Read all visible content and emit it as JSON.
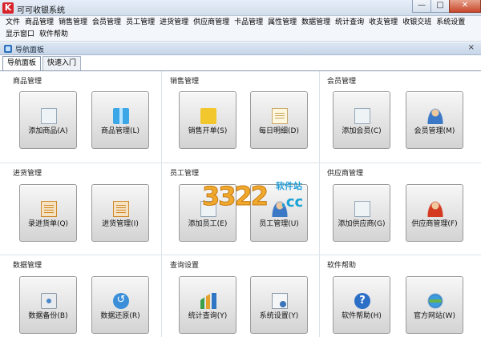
{
  "window": {
    "logo_letter": "K",
    "title": "可可收银系统",
    "buttons": [
      "—",
      "□",
      "✕"
    ]
  },
  "menu": [
    "文件",
    "商品管理",
    "销售管理",
    "会员管理",
    "员工管理",
    "进货管理",
    "供应商管理",
    "卡品管理",
    "属性管理",
    "数据管理",
    "统计查询",
    "收支管理",
    "收银交班",
    "系统设置",
    "显示窗口",
    "软件帮助"
  ],
  "nav_panel": {
    "title": "导航面板",
    "close": "×",
    "tabs": [
      {
        "label": "导航面板",
        "active": true
      },
      {
        "label": "快速入门",
        "active": false
      }
    ]
  },
  "groups": [
    {
      "title": "商品管理",
      "tiles": [
        {
          "label": "添加商品(A)",
          "icon": "add-product-icon"
        },
        {
          "label": "商品管理(L)",
          "icon": "gift-icon"
        }
      ]
    },
    {
      "title": "销售管理",
      "tiles": [
        {
          "label": "销售开单(S)",
          "icon": "shopping-bag-icon"
        },
        {
          "label": "每日明细(D)",
          "icon": "daily-detail-icon"
        }
      ]
    },
    {
      "title": "会员管理",
      "tiles": [
        {
          "label": "添加会员(C)",
          "icon": "add-member-icon"
        },
        {
          "label": "会员管理(M)",
          "icon": "member-icon"
        }
      ]
    },
    {
      "title": "进货管理",
      "tiles": [
        {
          "label": "录进货单(Q)",
          "icon": "purchase-order-icon"
        },
        {
          "label": "进货管理(I)",
          "icon": "purchase-list-icon"
        }
      ]
    },
    {
      "title": "员工管理",
      "tiles": [
        {
          "label": "添加员工(E)",
          "icon": "add-staff-icon"
        },
        {
          "label": "员工管理(U)",
          "icon": "staff-icon"
        }
      ]
    },
    {
      "title": "供应商管理",
      "tiles": [
        {
          "label": "添加供应商(G)",
          "icon": "add-supplier-icon"
        },
        {
          "label": "供应商管理(F)",
          "icon": "supplier-icon"
        }
      ]
    },
    {
      "title": "数据管理",
      "tiles": [
        {
          "label": "数据备份(B)",
          "icon": "backup-disk-icon"
        },
        {
          "label": "数据还原(R)",
          "icon": "restore-icon"
        }
      ]
    },
    {
      "title": "查询设置",
      "tiles": [
        {
          "label": "统计查询(Y)",
          "icon": "bar-chart-icon"
        },
        {
          "label": "系统设置(Y)",
          "icon": "settings-icon"
        }
      ]
    },
    {
      "title": "软件帮助",
      "tiles": [
        {
          "label": "软件帮助(H)",
          "icon": "help-icon"
        },
        {
          "label": "官方网站(W)",
          "icon": "globe-icon"
        }
      ]
    }
  ],
  "watermark": {
    "number": "3322",
    "domain": ".cc",
    "chinese": "软件站"
  },
  "colors": {
    "accent_red": "#d8232a",
    "panel_blue": "#c6d5e8",
    "tile_gray": "#d3d3d3"
  }
}
